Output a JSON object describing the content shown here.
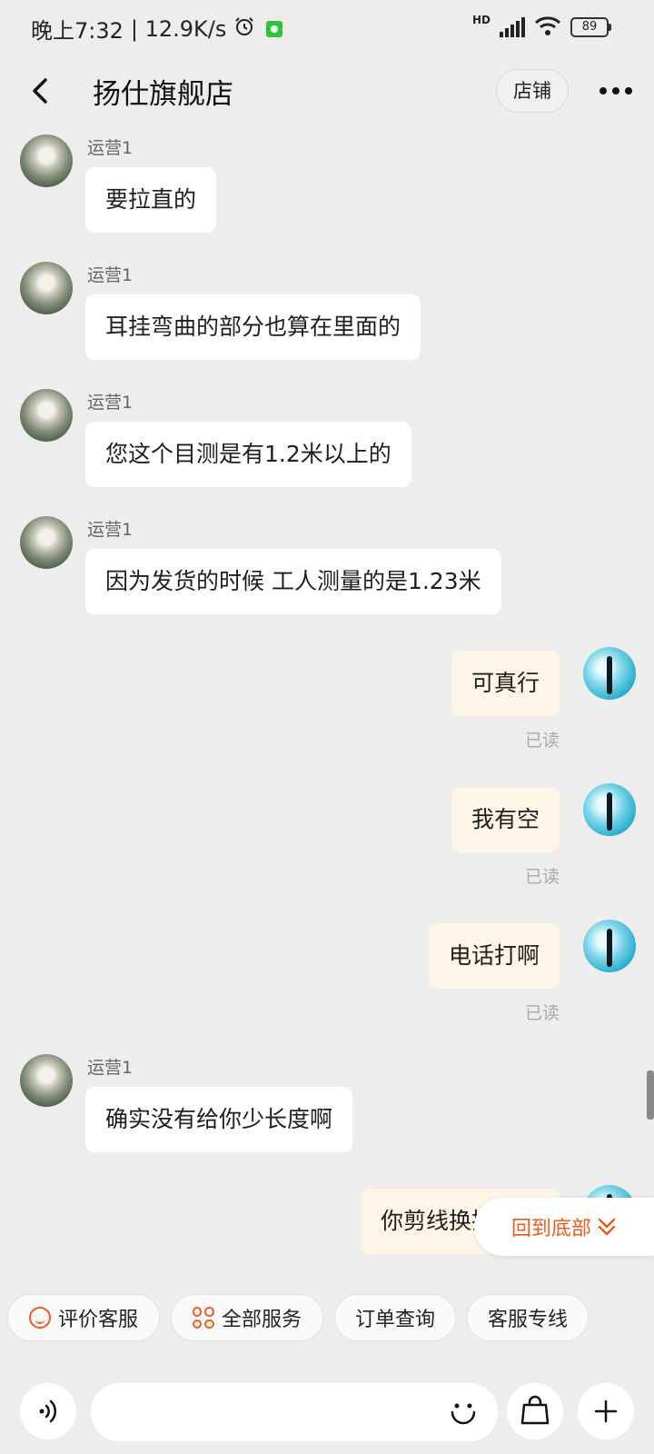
{
  "status_bar": {
    "time": "晚上7:32",
    "net_speed": "| 12.9K/s",
    "signal_label": "HD",
    "battery": "89"
  },
  "header": {
    "title": "扬仕旗舰店",
    "shop_button": "店铺"
  },
  "messages": [
    {
      "side": "left",
      "sender": "运营1",
      "text": "要拉直的"
    },
    {
      "side": "left",
      "sender": "运营1",
      "text": "耳挂弯曲的部分也算在里面的"
    },
    {
      "side": "left",
      "sender": "运营1",
      "text": "您这个目测是有1.2米以上的"
    },
    {
      "side": "left",
      "sender": "运营1",
      "text": "因为发货的时候 工人测量的是1.23米"
    },
    {
      "side": "right",
      "text": "可真行",
      "status": "已读"
    },
    {
      "side": "right",
      "text": "我有空",
      "status": "已读"
    },
    {
      "side": "right",
      "text": "电话打啊",
      "status": "已读"
    },
    {
      "side": "left",
      "sender": "运营1",
      "text": "确实没有给你少长度啊"
    },
    {
      "side": "right",
      "text": "你剪线换插针了"
    }
  ],
  "scroll_to_bottom": "回到底部",
  "quick_actions": [
    "评价客服",
    "全部服务",
    "订单查询",
    "客服专线"
  ]
}
